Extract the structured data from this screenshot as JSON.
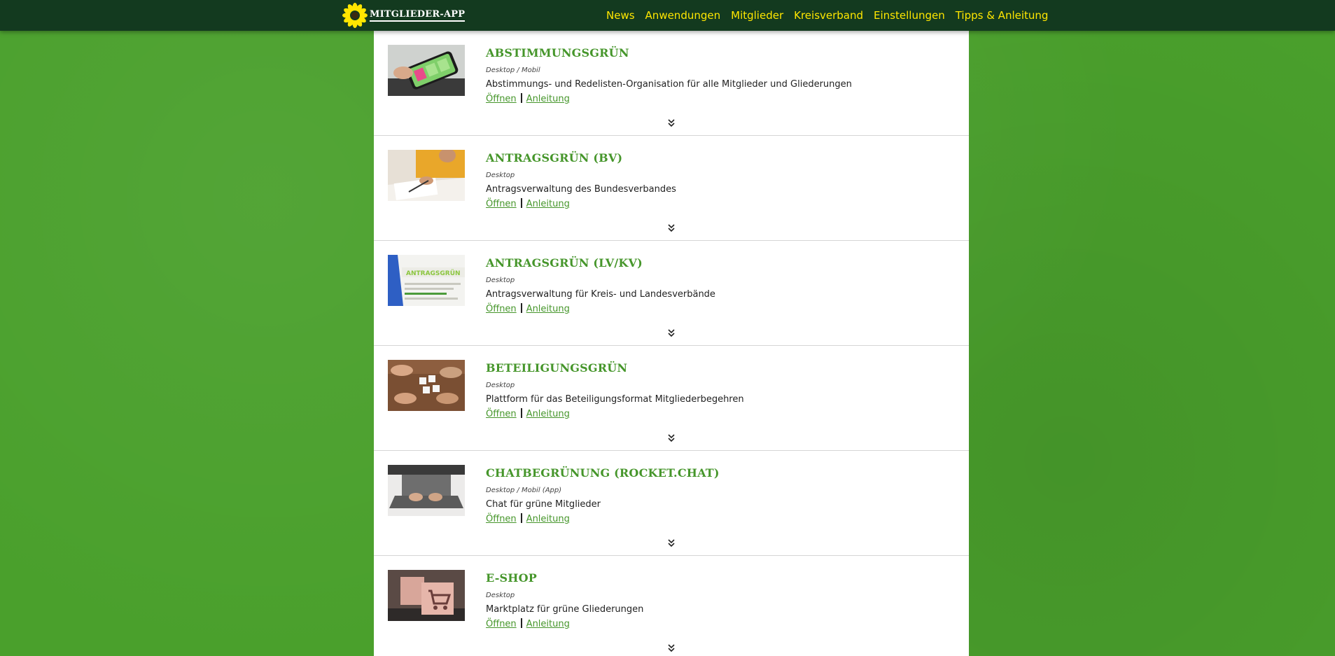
{
  "header": {
    "logo_text": "MITGLIEDER-APP",
    "nav": [
      "News",
      "Anwendungen",
      "Mitglieder",
      "Kreisverband",
      "Einstellungen",
      "Tipps & Anleitung"
    ]
  },
  "colors": {
    "brand_green": "#46962b",
    "nav_yellow": "#ffe600",
    "topbar": "#133a1f",
    "background": "#4aa02c"
  },
  "apps": [
    {
      "title": "ABSTIMMUNGSGRÜN",
      "platform": "Desktop / Mobil",
      "description": "Abstimmungs- und Redelisten-Organisation für alle Mitglieder und Gliederungen",
      "open_label": "Öffnen",
      "guide_label": "Anleitung",
      "thumb_icon": "phone-voting-image"
    },
    {
      "title": "ANTRAGSGRÜN (BV)",
      "platform": "Desktop",
      "description": "Antragsverwaltung des Bundesverbandes",
      "open_label": "Öffnen",
      "guide_label": "Anleitung",
      "thumb_icon": "signing-document-image"
    },
    {
      "title": "ANTRAGSGRÜN (LV/KV)",
      "platform": "Desktop",
      "description": "Antragsverwaltung für Kreis- und Landesverbände",
      "open_label": "Öffnen",
      "guide_label": "Anleitung",
      "thumb_icon": "antragsgruen-screen-image",
      "thumb_text": "ANTRAGSGRÜN"
    },
    {
      "title": "BETEILIGUNGSGRÜN",
      "platform": "Desktop",
      "description": "Plattform für das Beteiligungsformat Mitgliederbegehren",
      "open_label": "Öffnen",
      "guide_label": "Anleitung",
      "thumb_icon": "puzzle-hands-image"
    },
    {
      "title": "CHATBEGRÜNUNG (ROCKET.CHAT)",
      "platform": "Desktop / Mobil (App)",
      "description": "Chat für grüne Mitglieder",
      "open_label": "Öffnen",
      "guide_label": "Anleitung",
      "thumb_icon": "laptop-typing-image"
    },
    {
      "title": "E-SHOP",
      "platform": "Desktop",
      "description": "Marktplatz für grüne Gliederungen",
      "open_label": "Öffnen",
      "guide_label": "Anleitung",
      "thumb_icon": "shopping-cart-box-image"
    }
  ]
}
